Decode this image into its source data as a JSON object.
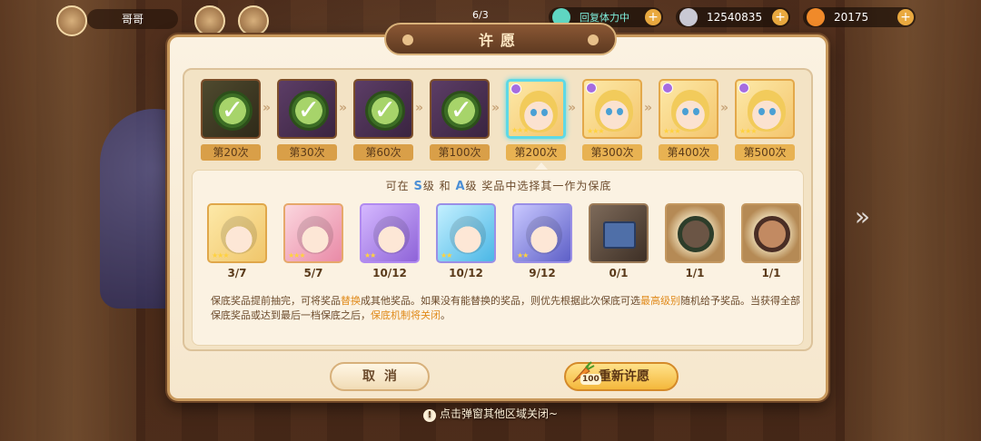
{
  "topbar": {
    "player_name": "哥哥",
    "energy_label": "回复体力中",
    "coins": "12540835",
    "carrots": "20175",
    "center_text": "6/3"
  },
  "modal": {
    "title": "许愿",
    "milestones": [
      {
        "label": "第20次",
        "state": "done"
      },
      {
        "label": "第30次",
        "state": "done"
      },
      {
        "label": "第60次",
        "state": "done"
      },
      {
        "label": "第100次",
        "state": "done"
      },
      {
        "label": "第200次",
        "state": "current"
      },
      {
        "label": "第300次",
        "state": "future"
      },
      {
        "label": "第400次",
        "state": "future"
      },
      {
        "label": "第500次",
        "state": "future"
      }
    ],
    "guarantee": {
      "title_prefix": "可在",
      "grade_s": "S",
      "title_mid1": "级 和",
      "grade_a": "A",
      "title_suffix": "级 奖品中选择其一作为保底",
      "rewards": [
        {
          "count": "3/7",
          "style": "gold"
        },
        {
          "count": "5/7",
          "style": "pink"
        },
        {
          "count": "10/12",
          "style": "violet"
        },
        {
          "count": "10/12",
          "style": "teal"
        },
        {
          "count": "9/12",
          "style": "navy"
        },
        {
          "count": "0/1",
          "style": "dark"
        },
        {
          "count": "1/1",
          "style": "relic"
        },
        {
          "count": "1/1",
          "style": "relic"
        }
      ],
      "desc_part1": "保底奖品提前抽完，可将奖品",
      "desc_warn1": "替换",
      "desc_part2": "成其他奖品。如果没有能替换的奖品，则优先根据此次保底可选",
      "desc_warn2": "最高级别",
      "desc_part3": "随机给予奖品。当获得全部保底奖品或达到最后一档保底之后，",
      "desc_warn3": "保底机制将关闭",
      "desc_part4": "。"
    },
    "cancel_label": "取消",
    "rewish_label": "重新许愿",
    "rewish_cost": "100"
  },
  "hint": {
    "text": "点击弹窗其他区域关闭~"
  },
  "colors": {
    "accent": "#f4b83c",
    "highlight_blue": "#4c8fd6",
    "warn_orange": "#e08a1a",
    "current_frame": "#5ed9e6"
  }
}
